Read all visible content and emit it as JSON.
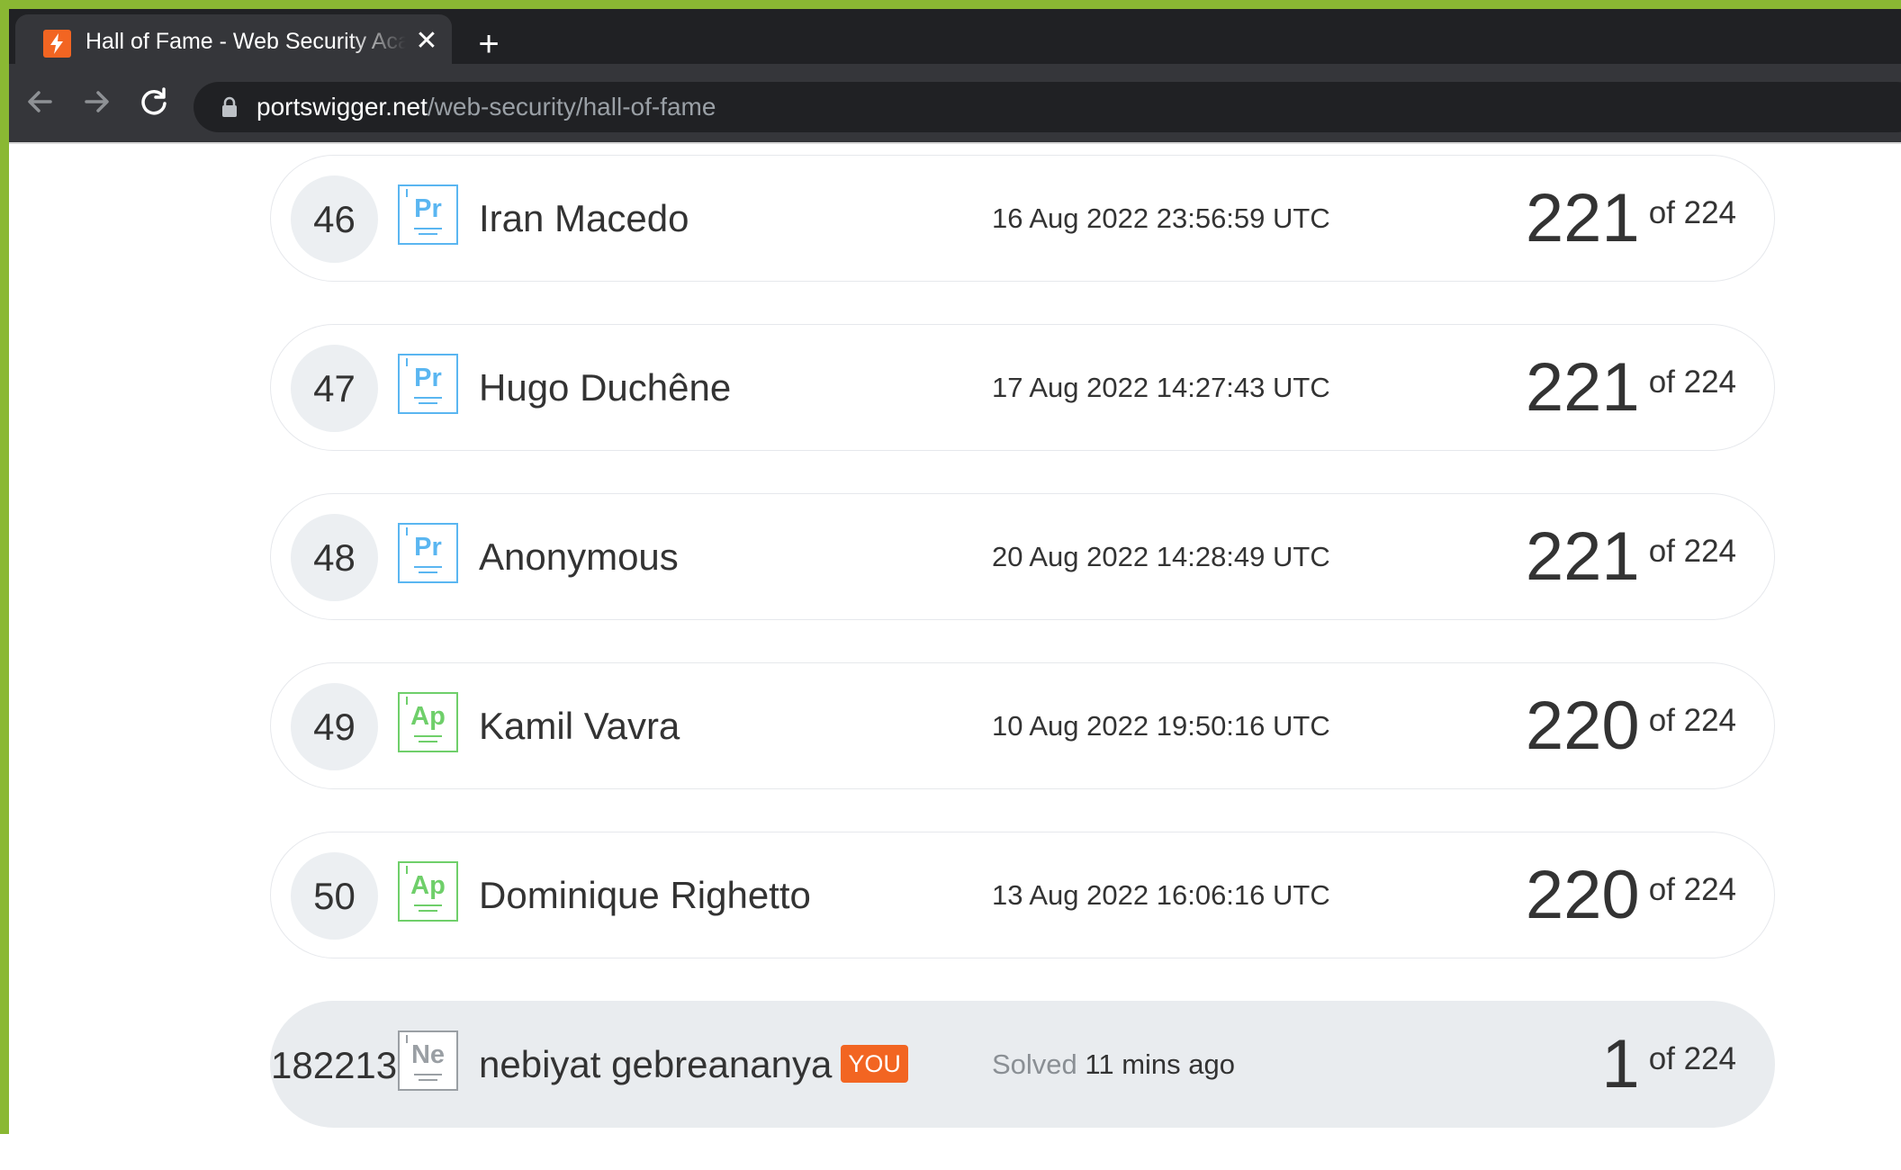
{
  "browser": {
    "tab_title": "Hall of Fame - Web Security Academy",
    "new_tab_label": "+",
    "close_label": "✕",
    "url_host": "portswigger.net",
    "url_path": "/web-security/hall-of-fame"
  },
  "colors": {
    "practitioner": "#5ab6f1",
    "apprentice": "#6fcf6a",
    "newcomer": "#9a9fa4",
    "you_badge": "#f26522",
    "window_frame": "#8ab833"
  },
  "leaderboard": [
    {
      "rank": "46",
      "level": "Pr",
      "level_color": "#5ab6f1",
      "name": "Iran Macedo",
      "date": "16 Aug 2022 23:56:59 UTC",
      "score": "221",
      "total": "of 224"
    },
    {
      "rank": "47",
      "level": "Pr",
      "level_color": "#5ab6f1",
      "name": "Hugo Duchêne",
      "date": "17 Aug 2022 14:27:43 UTC",
      "score": "221",
      "total": "of 224"
    },
    {
      "rank": "48",
      "level": "Pr",
      "level_color": "#5ab6f1",
      "name": "Anonymous",
      "date": "20 Aug 2022 14:28:49 UTC",
      "score": "221",
      "total": "of 224"
    },
    {
      "rank": "49",
      "level": "Ap",
      "level_color": "#6fcf6a",
      "name": "Kamil Vavra",
      "date": "10 Aug 2022 19:50:16 UTC",
      "score": "220",
      "total": "of 224"
    },
    {
      "rank": "50",
      "level": "Ap",
      "level_color": "#6fcf6a",
      "name": "Dominique Righetto",
      "date": "13 Aug 2022 16:06:16 UTC",
      "score": "220",
      "total": "of 224"
    }
  ],
  "current_user": {
    "rank": "182213",
    "level": "Ne",
    "level_color": "#9a9fa4",
    "name": "nebiyat gebreananya",
    "you_label": "YOU",
    "solved_label": "Solved",
    "solved_time": "11 mins ago",
    "score": "1",
    "total": "of 224"
  }
}
